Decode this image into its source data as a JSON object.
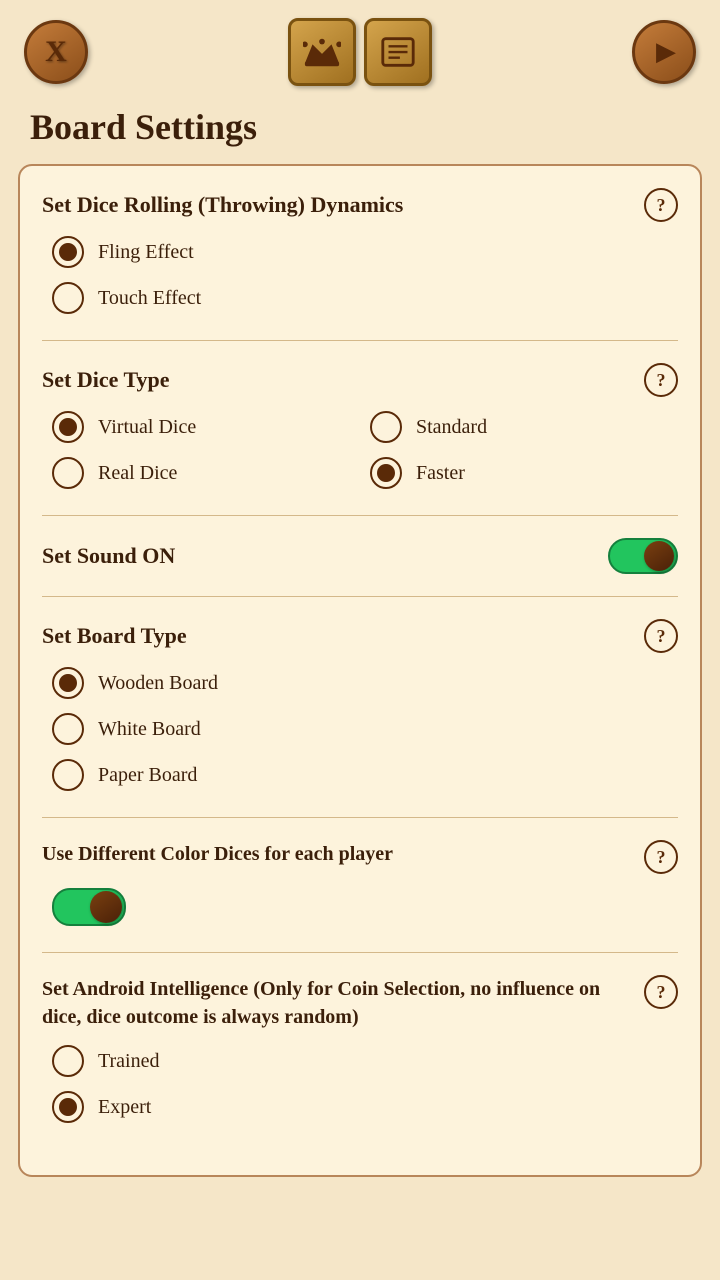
{
  "topBar": {
    "closeLabel": "X",
    "playLabel": "▶",
    "crownTitle": "Crown",
    "scoreTitle": "Score"
  },
  "pageTitle": "Board Settings",
  "sections": {
    "diceRolling": {
      "title": "Set Dice Rolling (Throwing) Dynamics",
      "helpLabel": "?",
      "options": [
        {
          "id": "fling",
          "label": "Fling Effect",
          "selected": true
        },
        {
          "id": "touch",
          "label": "Touch Effect",
          "selected": false
        }
      ]
    },
    "diceType": {
      "title": "Set Dice Type",
      "helpLabel": "?",
      "options": [
        {
          "id": "virtual",
          "label": "Virtual Dice",
          "selected": true
        },
        {
          "id": "standard",
          "label": "Standard",
          "selected": false
        },
        {
          "id": "real",
          "label": "Real Dice",
          "selected": false
        },
        {
          "id": "faster",
          "label": "Faster",
          "selected": true
        }
      ]
    },
    "sound": {
      "title": "Set Sound ON",
      "toggleOn": true
    },
    "boardType": {
      "title": "Set Board Type",
      "helpLabel": "?",
      "options": [
        {
          "id": "wooden",
          "label": "Wooden Board",
          "selected": true
        },
        {
          "id": "white",
          "label": "White Board",
          "selected": false
        },
        {
          "id": "paper",
          "label": "Paper Board",
          "selected": false
        }
      ]
    },
    "colorDices": {
      "title": "Use Different Color Dices for each player",
      "helpLabel": "?",
      "toggleOn": true
    },
    "androidIntelligence": {
      "title": "Set Android Intelligence (Only for Coin Selection, no influence on dice, dice outcome is always random)",
      "helpLabel": "?",
      "options": [
        {
          "id": "trained",
          "label": "Trained",
          "selected": false
        },
        {
          "id": "expert",
          "label": "Expert",
          "selected": true
        }
      ]
    }
  }
}
